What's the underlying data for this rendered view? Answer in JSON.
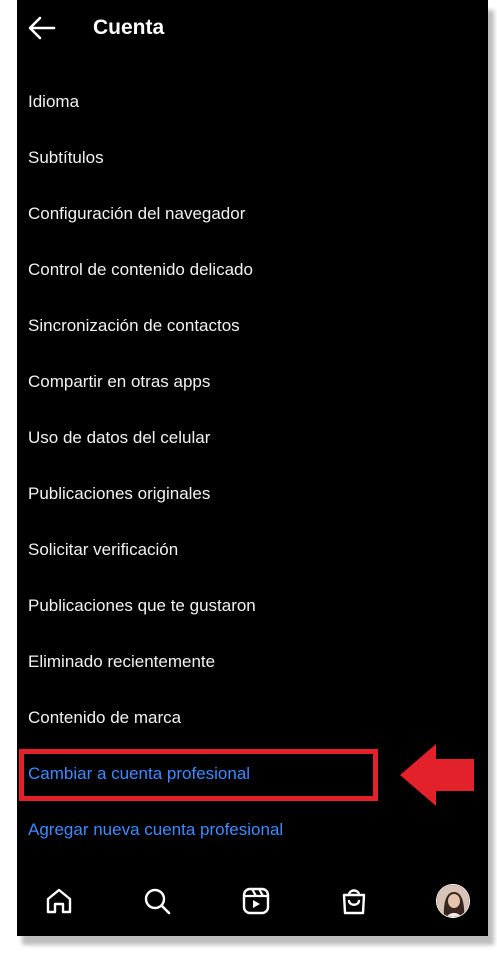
{
  "header": {
    "title": "Cuenta",
    "back_icon": "arrow-left-icon"
  },
  "menu": {
    "items": [
      {
        "label": "Idioma"
      },
      {
        "label": "Subtítulos"
      },
      {
        "label": "Configuración del navegador"
      },
      {
        "label": "Control de contenido delicado"
      },
      {
        "label": "Sincronización de contactos"
      },
      {
        "label": "Compartir en otras apps"
      },
      {
        "label": "Uso de datos del celular"
      },
      {
        "label": "Publicaciones originales"
      },
      {
        "label": "Solicitar verificación"
      },
      {
        "label": "Publicaciones que te gustaron"
      },
      {
        "label": "Eliminado recientemente"
      },
      {
        "label": "Contenido de marca"
      }
    ],
    "links": [
      {
        "label": "Cambiar a cuenta profesional"
      },
      {
        "label": "Agregar nueva cuenta profesional"
      }
    ]
  },
  "bottom_nav": {
    "icons": [
      "home-icon",
      "search-icon",
      "reels-icon",
      "shop-icon",
      "profile-avatar"
    ]
  },
  "colors": {
    "background": "#000000",
    "text": "#f2f2f2",
    "link": "#3d8bff",
    "highlight": "#e3212a"
  }
}
